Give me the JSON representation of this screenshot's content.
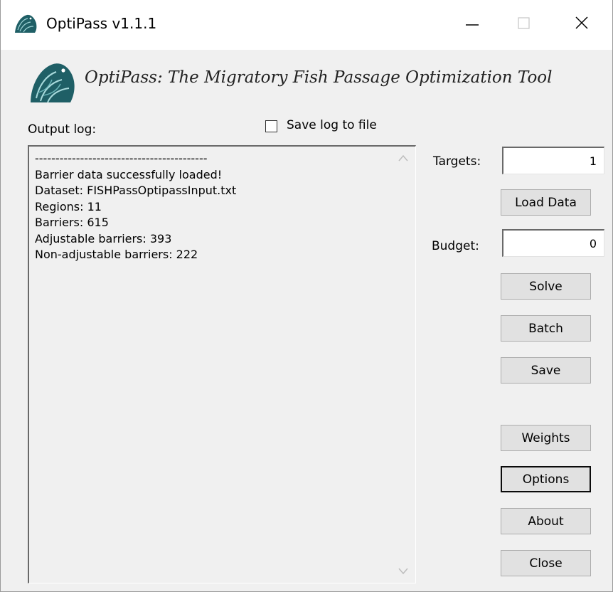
{
  "window": {
    "title": "OptiPass v1.1.1",
    "icon": "fish-icon",
    "controls": {
      "minimize": "minimize-icon",
      "maximize": "maximize-icon",
      "close": "close-icon"
    }
  },
  "banner": {
    "text": "OptiPass: The Migratory Fish Passage Optimization Tool"
  },
  "log": {
    "label": "Output log:",
    "save_checkbox_label": "Save log to file",
    "save_checked": false,
    "lines": [
      "------------------------------------------",
      "Barrier data successfully loaded!",
      "Dataset: FISHPassOptipassInput.txt",
      "Regions: 11",
      "Barriers: 615",
      "Adjustable barriers: 393",
      "Non-adjustable barriers: 222"
    ]
  },
  "targets": {
    "label": "Targets:",
    "value": "1"
  },
  "budget": {
    "label": "Budget:",
    "value": "0"
  },
  "buttons": {
    "load_data": "Load Data",
    "solve": "Solve",
    "batch": "Batch",
    "save": "Save",
    "weights": "Weights",
    "options": "Options",
    "about": "About",
    "close": "Close"
  },
  "colors": {
    "window_bg": "#f0f0f0",
    "titlebar_bg": "#ffffff",
    "logo_teal": "#1f5f66"
  }
}
